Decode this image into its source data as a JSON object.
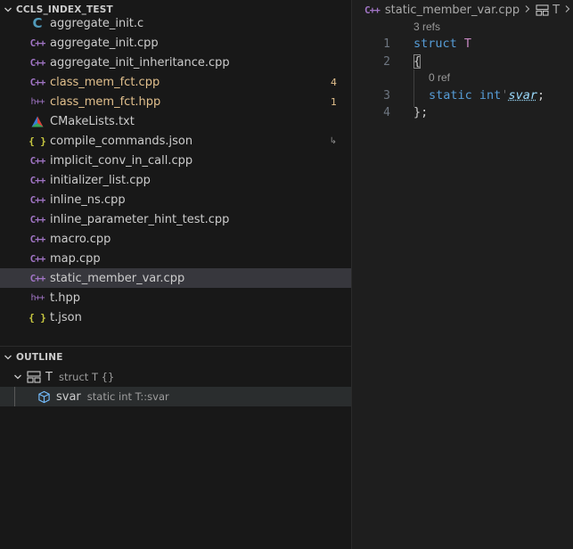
{
  "explorer": {
    "title": "CCLS_INDEX_TEST",
    "files": [
      {
        "name": "aggregate_init.c",
        "icon": "c-file-icon",
        "modified": false,
        "badge": ""
      },
      {
        "name": "aggregate_init.cpp",
        "icon": "cpp-file-icon",
        "modified": false,
        "badge": ""
      },
      {
        "name": "aggregate_init_inheritance.cpp",
        "icon": "cpp-file-icon",
        "modified": false,
        "badge": ""
      },
      {
        "name": "class_mem_fct.cpp",
        "icon": "cpp-file-icon",
        "modified": true,
        "badge": "4"
      },
      {
        "name": "class_mem_fct.hpp",
        "icon": "hpp-file-icon",
        "modified": true,
        "badge": "1"
      },
      {
        "name": "CMakeLists.txt",
        "icon": "cmake-file-icon",
        "modified": false,
        "badge": ""
      },
      {
        "name": "compile_commands.json",
        "icon": "json-file-icon",
        "modified": false,
        "badge": "↳"
      },
      {
        "name": "implicit_conv_in_call.cpp",
        "icon": "cpp-file-icon",
        "modified": false,
        "badge": ""
      },
      {
        "name": "initializer_list.cpp",
        "icon": "cpp-file-icon",
        "modified": false,
        "badge": ""
      },
      {
        "name": "inline_ns.cpp",
        "icon": "cpp-file-icon",
        "modified": false,
        "badge": ""
      },
      {
        "name": "inline_parameter_hint_test.cpp",
        "icon": "cpp-file-icon",
        "modified": false,
        "badge": ""
      },
      {
        "name": "macro.cpp",
        "icon": "cpp-file-icon",
        "modified": false,
        "badge": ""
      },
      {
        "name": "map.cpp",
        "icon": "cpp-file-icon",
        "modified": false,
        "badge": ""
      },
      {
        "name": "static_member_var.cpp",
        "icon": "cpp-file-icon",
        "modified": false,
        "badge": "",
        "selected": true
      },
      {
        "name": "t.hpp",
        "icon": "hpp-file-icon",
        "modified": false,
        "badge": ""
      },
      {
        "name": "t.json",
        "icon": "json-file-icon",
        "modified": false,
        "badge": ""
      }
    ]
  },
  "outline": {
    "title": "OUTLINE",
    "items": [
      {
        "name": "T",
        "detail": "struct T {}",
        "icon": "struct-icon"
      },
      {
        "name": "svar",
        "detail": "static int T::svar",
        "icon": "field-icon"
      }
    ]
  },
  "editor": {
    "breadcrumb": {
      "file": "static_member_var.cpp",
      "symbol": "T"
    },
    "lens_struct": "3 refs",
    "lens_field": "0 ref",
    "line_numbers": [
      "1",
      "2",
      "3",
      "4"
    ],
    "tokens": {
      "struct_kw": "struct",
      "struct_name": "T",
      "open_brace": "{",
      "static_kw": "static",
      "int_kw": "int",
      "var_name": "svar",
      "semicolon": ";",
      "close_brace": "};"
    }
  },
  "colors": {
    "modified": "#e2c08d",
    "keyword": "#569cd6",
    "type": "#c586c0",
    "variable": "#9cdcfe"
  }
}
